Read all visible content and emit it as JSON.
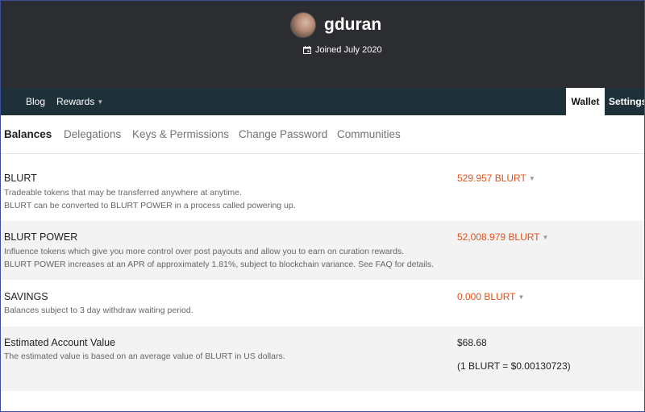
{
  "profile": {
    "username": "gduran",
    "joined": "Joined July 2020"
  },
  "nav": {
    "blog": "Blog",
    "rewards": "Rewards",
    "wallet": "Wallet",
    "settings": "Settings"
  },
  "tabs": [
    {
      "label": "Balances",
      "active": true
    },
    {
      "label": "Delegations",
      "active": false
    },
    {
      "label": "Keys & Permissions",
      "active": false
    },
    {
      "label": "Change Password",
      "active": false
    },
    {
      "label": "Communities",
      "active": false
    }
  ],
  "balances": {
    "blurt": {
      "title": "BLURT",
      "desc1": "Tradeable tokens that may be transferred anywhere at anytime.",
      "desc2": "BLURT can be converted to BLURT POWER in a process called powering up.",
      "amount": "529.957 BLURT"
    },
    "power": {
      "title": "BLURT POWER",
      "desc1": "Influence tokens which give you more control over post payouts and allow you to earn on curation rewards.",
      "desc2": "BLURT POWER increases at an APR of approximately 1.81%, subject to blockchain variance. See FAQ for details.",
      "amount": "52,008.979 BLURT"
    },
    "savings": {
      "title": "SAVINGS",
      "desc1": "Balances subject to 3 day withdraw waiting period.",
      "amount": "0.000 BLURT"
    },
    "estimate": {
      "title": "Estimated Account Value",
      "desc1": "The estimated value is based on an average value of BLURT in US dollars.",
      "value": "$68.68",
      "rate": "(1 BLURT = $0.00130723)"
    }
  },
  "colors": {
    "header_bg": "#2c2d30",
    "nav_bg": "#1f3138",
    "accent_amount": "#e0521c"
  }
}
